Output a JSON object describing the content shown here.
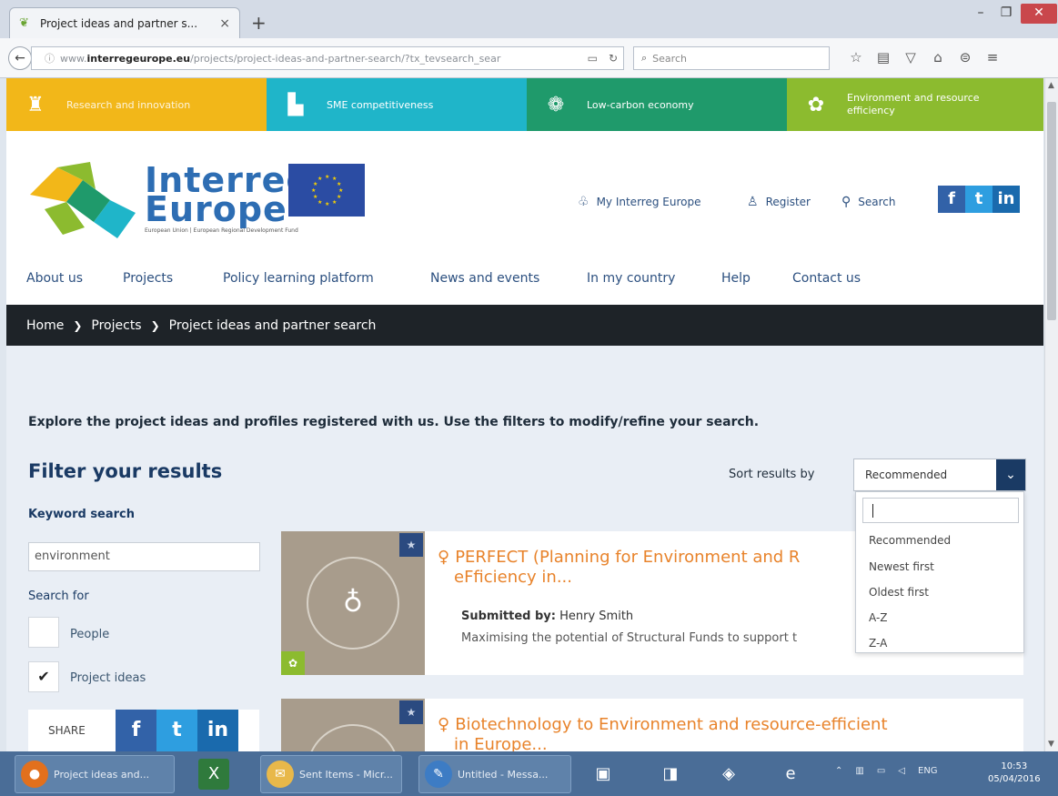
{
  "browser": {
    "tab_title": "Project ideas and partner s...",
    "tab_close": "×",
    "new_tab": "+",
    "url_prefix": "www.",
    "url_domain": "interregeurope.eu",
    "url_path": "/projects/project-ideas-and-partner-search/?tx_tevsearch_sear",
    "search_placeholder": "Search",
    "min": "–",
    "max": "❐",
    "close": "✕"
  },
  "topics": [
    {
      "label": "Research and innovation",
      "icon": "lighthouse-icon"
    },
    {
      "label": "SME competitiveness",
      "icon": "buildings-icon"
    },
    {
      "label": "Low-carbon economy",
      "icon": "globe-leaf-icon"
    },
    {
      "label": "Environment and resource efficiency",
      "icon": "plant-icon"
    }
  ],
  "header": {
    "logo_line1": "Interreg",
    "logo_line2": "Europe",
    "logo_sub": "European Union | European Regional Development Fund",
    "my_interreg": "My Interreg Europe",
    "register": "Register",
    "search": "Search",
    "social_fb": "f",
    "social_tw": "t",
    "social_in": "in"
  },
  "nav": [
    "About us",
    "Projects",
    "Policy learning platform",
    "News and events",
    "In my country",
    "Help",
    "Contact us"
  ],
  "breadcrumb": [
    "Home",
    "Projects",
    "Project ideas and partner search"
  ],
  "content": {
    "intro": "Explore the project ideas and profiles registered with us. Use the filters to modify/refine your search.",
    "filter_title": "Filter your results",
    "sort_label": "Sort results by",
    "sort_value": "Recommended",
    "sort_options": [
      "Recommended",
      "Newest first",
      "Oldest first",
      "A-Z",
      "Z-A"
    ],
    "keyword_label": "Keyword search",
    "keyword_value": "environment",
    "search_for_label": "Search for",
    "options": [
      {
        "label": "People",
        "checked": false
      },
      {
        "label": "Project ideas",
        "checked": true
      }
    ],
    "share_label": "SHARE"
  },
  "results": [
    {
      "title": "PERFECT (Planning for Environment and R",
      "title_line2": "eFficiency in...",
      "submitted_label": "Submitted by:",
      "submitted_by": "Henry Smith",
      "desc": "Maximising the potential of Structural Funds to support t"
    },
    {
      "title": "Biotechnology to Environment and resource-efficient",
      "title_line2": "in Europe..."
    }
  ],
  "taskbar": {
    "items": [
      "Project ideas and...",
      "Sent Items - Micr...",
      "Untitled - Messa..."
    ],
    "lang": "ENG",
    "time": "10:53",
    "date": "05/04/2016"
  }
}
